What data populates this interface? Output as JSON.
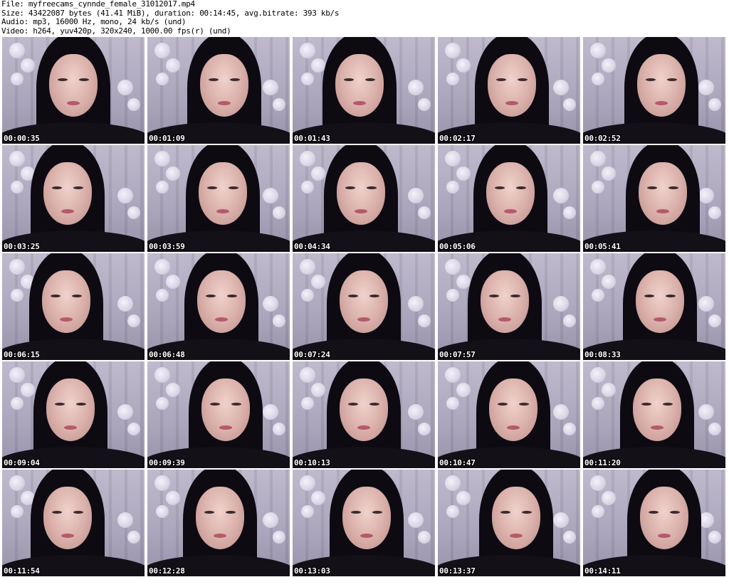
{
  "header": {
    "file_line": "File: myfreecams_cynnde_female_31012017.mp4",
    "size_line": "Size: 43422087 bytes (41.41 MiB), duration: 00:14:45, avg.bitrate: 393 kb/s",
    "audio_line": "Audio: mp3, 16000 Hz, mono, 24 kb/s (und)",
    "video_line": "Video: h264, yuv420p, 320x240, 1000.00 fps(r) (und)"
  },
  "thumbnails": [
    {
      "timestamp": "00:00:35"
    },
    {
      "timestamp": "00:01:09"
    },
    {
      "timestamp": "00:01:43"
    },
    {
      "timestamp": "00:02:17"
    },
    {
      "timestamp": "00:02:52"
    },
    {
      "timestamp": "00:03:25"
    },
    {
      "timestamp": "00:03:59"
    },
    {
      "timestamp": "00:04:34"
    },
    {
      "timestamp": "00:05:06"
    },
    {
      "timestamp": "00:05:41"
    },
    {
      "timestamp": "00:06:15"
    },
    {
      "timestamp": "00:06:48"
    },
    {
      "timestamp": "00:07:24"
    },
    {
      "timestamp": "00:07:57"
    },
    {
      "timestamp": "00:08:33"
    },
    {
      "timestamp": "00:09:04"
    },
    {
      "timestamp": "00:09:39"
    },
    {
      "timestamp": "00:10:13"
    },
    {
      "timestamp": "00:10:47"
    },
    {
      "timestamp": "00:11:20"
    },
    {
      "timestamp": "00:11:54"
    },
    {
      "timestamp": "00:12:28"
    },
    {
      "timestamp": "00:13:03"
    },
    {
      "timestamp": "00:13:37"
    },
    {
      "timestamp": "00:14:11"
    }
  ]
}
